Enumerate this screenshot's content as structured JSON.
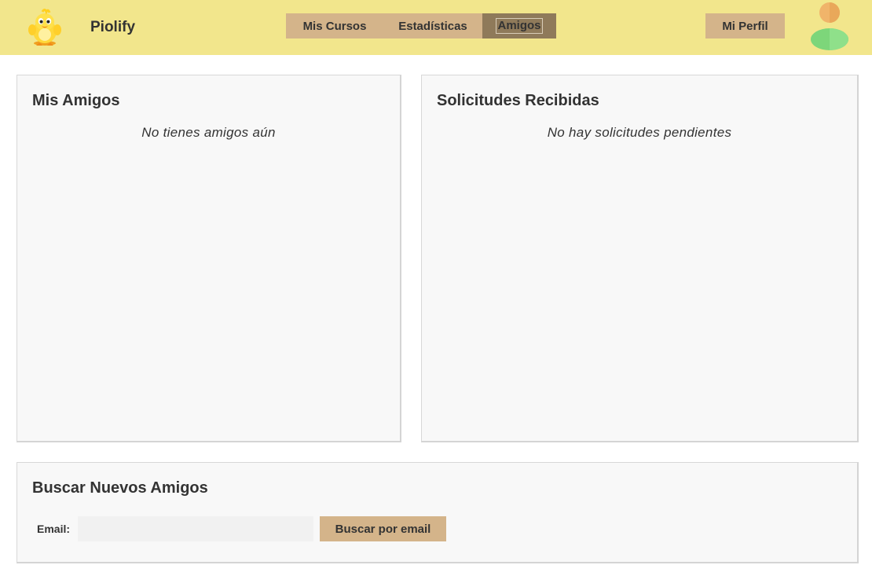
{
  "header": {
    "logo_icon": "chick-mascot-icon",
    "brand": "Piolify",
    "nav": [
      {
        "label": "Mis Cursos",
        "active": false
      },
      {
        "label": "Estadísticas",
        "active": false
      },
      {
        "label": "Amigos",
        "active": true
      }
    ],
    "profile_label": "Mi Perfil",
    "avatar_icon": "user-avatar-icon"
  },
  "friends_panel": {
    "title": "Mis Amigos",
    "empty_message": "No tienes amigos aún"
  },
  "requests_panel": {
    "title": "Solicitudes Recibidas",
    "empty_message": "No hay solicitudes pendientes"
  },
  "search_panel": {
    "title": "Buscar Nuevos Amigos",
    "email_label": "Email:",
    "email_value": "",
    "email_placeholder": "",
    "button_label": "Buscar por email"
  },
  "colors": {
    "header_bg": "#f2e68c",
    "button_bg": "#d4b48a",
    "active_tab_bg": "#8f7a5a",
    "panel_bg": "#f8f8f8",
    "avatar_head": "#f0b46a",
    "avatar_body": "#7dd67a"
  }
}
